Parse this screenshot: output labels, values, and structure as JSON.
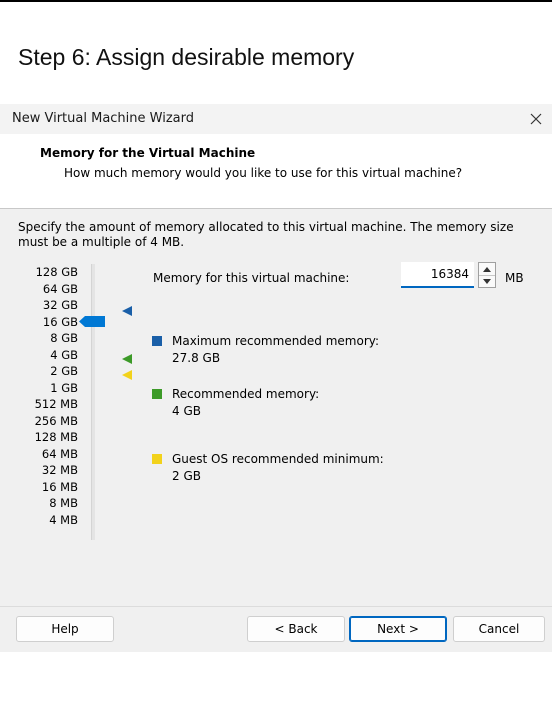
{
  "page": {
    "heading": "Step 6: Assign desirable memory"
  },
  "window": {
    "title": "New Virtual Machine Wizard",
    "close_icon": "close-icon"
  },
  "header": {
    "title": "Memory for the Virtual Machine",
    "subtitle": "How much memory would you like to use for this virtual machine?"
  },
  "description": {
    "line1": "Specify the amount of memory allocated to this virtual machine. The memory size",
    "line2": "must be a multiple of 4 MB."
  },
  "scale": {
    "labels": [
      "128 GB",
      "64 GB",
      "32 GB",
      "16 GB",
      "8 GB",
      "4 GB",
      "2 GB",
      "1 GB",
      "512 MB",
      "256 MB",
      "128 MB",
      "64 MB",
      "32 MB",
      "16 MB",
      "8 MB",
      "4 MB"
    ],
    "selected_label": "16 GB"
  },
  "memory": {
    "label": "Memory for this virtual machine:",
    "value": "16384",
    "unit": "MB"
  },
  "legend": {
    "max": {
      "label": "Maximum recommended memory:",
      "value": "27.8 GB",
      "color": "#1a5fa8"
    },
    "recommended": {
      "label": "Recommended memory:",
      "value": "4 GB",
      "color": "#3c9a28"
    },
    "minimum": {
      "label": "Guest OS recommended minimum:",
      "value": "2 GB",
      "color": "#f2d21b"
    }
  },
  "colors": {
    "thumb": "#0078d4",
    "accent": "#0067c0"
  },
  "buttons": {
    "help": "Help",
    "back": "< Back",
    "next": "Next >",
    "cancel": "Cancel"
  }
}
